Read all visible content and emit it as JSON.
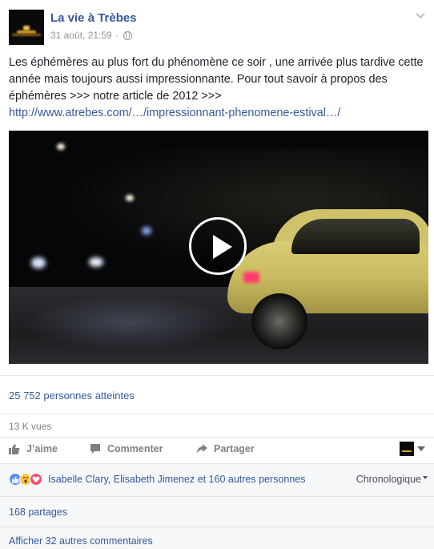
{
  "header": {
    "page_name": "La vie à Trèbes",
    "timestamp": "31 août, 21:59",
    "separator": "·"
  },
  "post": {
    "text": "Les éphémères au plus fort du phénomène ce soir , une arrivée plus tardive cette année mais toujours aussi impressionnante. Pour tout savoir à propos des éphémères >>> notre article de 2012 >>>",
    "link_text": "http://www.atrebes.com/…/impressionnant-phenomene-estival…/"
  },
  "stats": {
    "reach": "25 752 personnes atteintes",
    "views": "13 K vues"
  },
  "actions": {
    "like_label": "J’aime",
    "comment_label": "Commenter",
    "share_label": "Partager"
  },
  "reactions": {
    "names": "Isabelle Clary, Elisabeth Jimenez et 160 autres personnes",
    "icons": [
      "like",
      "wow",
      "love"
    ],
    "sort_label": "Chronologique"
  },
  "footer": {
    "shares": "168 partages",
    "more_comments": "Afficher 32 autres commentaires"
  },
  "colors": {
    "link": "#365899",
    "muted": "#90949c",
    "like": "#5890ff",
    "wow": "#f7c64a",
    "love": "#f25268"
  }
}
